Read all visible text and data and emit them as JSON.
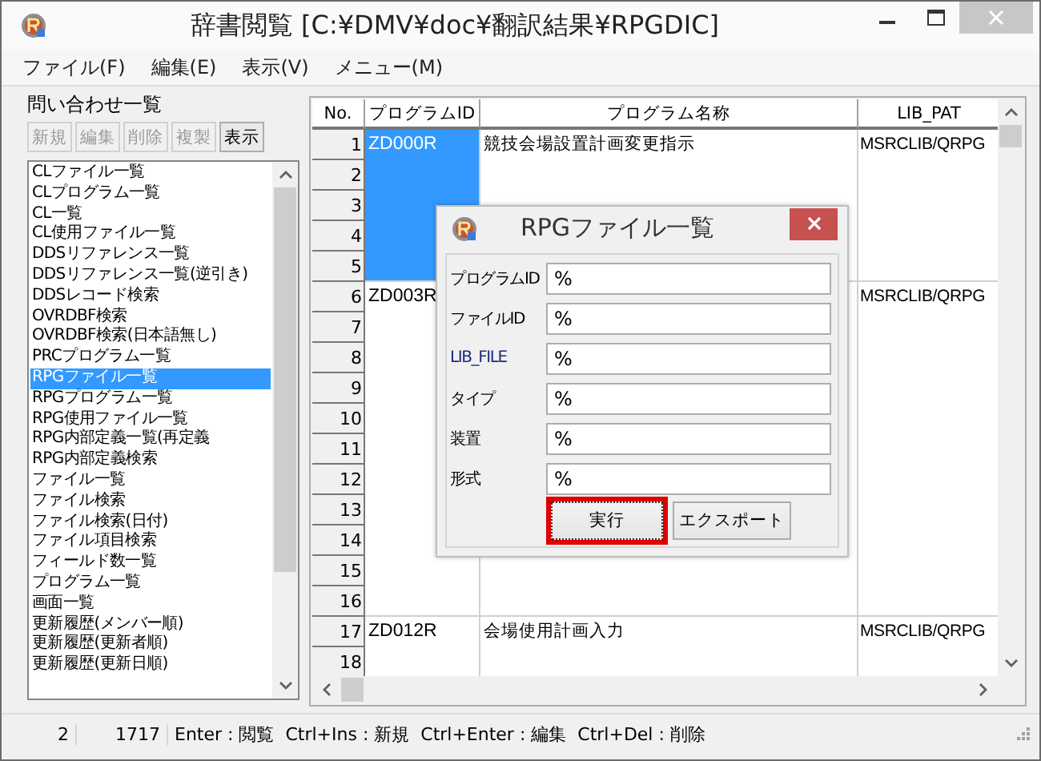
{
  "window": {
    "title": "辞書閲覧 [C:¥DMV¥doc¥翻訳結果¥RPGDIC]"
  },
  "menu": [
    "ファイル(F)",
    "編集(E)",
    "表示(V)",
    "メニュー(M)"
  ],
  "query_panel": {
    "title": "問い合わせ一覧",
    "buttons": [
      {
        "label": "新規",
        "disabled": true
      },
      {
        "label": "編集",
        "disabled": true
      },
      {
        "label": "削除",
        "disabled": true
      },
      {
        "label": "複製",
        "disabled": true
      },
      {
        "label": "表示",
        "disabled": false
      }
    ],
    "items": [
      {
        "label": "CLファイル一覧",
        "selected": false
      },
      {
        "label": "CLプログラム一覧",
        "selected": false
      },
      {
        "label": "CL一覧",
        "selected": false
      },
      {
        "label": "CL使用ファイル一覧",
        "selected": false
      },
      {
        "label": "DDSリファレンス一覧",
        "selected": false
      },
      {
        "label": "DDSリファレンス一覧(逆引き)",
        "selected": false
      },
      {
        "label": "DDSレコード検索",
        "selected": false
      },
      {
        "label": "OVRDBF検索",
        "selected": false
      },
      {
        "label": "OVRDBF検索(日本語無し)",
        "selected": false
      },
      {
        "label": "PRCプログラム一覧",
        "selected": false
      },
      {
        "label": "RPGファイル一覧",
        "selected": true
      },
      {
        "label": "RPGプログラム一覧",
        "selected": false
      },
      {
        "label": "RPG使用ファイル一覧",
        "selected": false
      },
      {
        "label": "RPG内部定義一覧(再定義",
        "selected": false
      },
      {
        "label": "RPG内部定義検索",
        "selected": false
      },
      {
        "label": "ファイル一覧",
        "selected": false
      },
      {
        "label": "ファイル検索",
        "selected": false
      },
      {
        "label": "ファイル検索(日付)",
        "selected": false
      },
      {
        "label": "ファイル項目検索",
        "selected": false
      },
      {
        "label": "フィールド数一覧",
        "selected": false
      },
      {
        "label": "プログラム一覧",
        "selected": false
      },
      {
        "label": "画面一覧",
        "selected": false
      },
      {
        "label": "更新履歴(メンバー順)",
        "selected": false
      },
      {
        "label": "更新履歴(更新者順)",
        "selected": false
      },
      {
        "label": "更新履歴(更新日順)",
        "selected": false
      }
    ]
  },
  "table": {
    "columns": [
      "No.",
      "プログラムID",
      "プログラム名称",
      "LIB_PAT"
    ],
    "records": [
      {
        "row_numbers": [
          "1",
          "2",
          "3",
          "4",
          "5"
        ],
        "program_id": "ZD000R",
        "program_name": "競技会場設置計画変更指示",
        "lib_path": "MSRCLIB/QRPG",
        "selected": true
      },
      {
        "row_numbers": [
          "6",
          "7",
          "8",
          "9",
          "10",
          "11",
          "12",
          "13",
          "14",
          "15",
          "16"
        ],
        "program_id": "ZD003R",
        "lib_path": "MSRCLIB/QRPG",
        "selected": false
      },
      {
        "row_numbers": [
          "17",
          "18"
        ],
        "program_id": "ZD012R",
        "program_name": "会場使用計画入力",
        "lib_path": "MSRCLIB/QRPG",
        "selected": false
      }
    ]
  },
  "dialog": {
    "title": "RPGファイル一覧",
    "fields": [
      {
        "label": "プログラムID",
        "value": "%"
      },
      {
        "label": "ファイルID",
        "value": "%"
      },
      {
        "label": "LIB_FILE",
        "value": "%"
      },
      {
        "label": "タイプ",
        "value": "%"
      },
      {
        "label": "装置",
        "value": "%"
      },
      {
        "label": "形式",
        "value": "%"
      }
    ],
    "buttons": [
      {
        "label": "実行",
        "focused": true
      },
      {
        "label": "エクスポート",
        "focused": false
      }
    ]
  },
  "status_bar": [
    "2",
    "1717",
    "Enter : 閲覧  Ctrl+Ins : 新規  Ctrl+Enter : 編集  Ctrl+Del : 削除"
  ]
}
